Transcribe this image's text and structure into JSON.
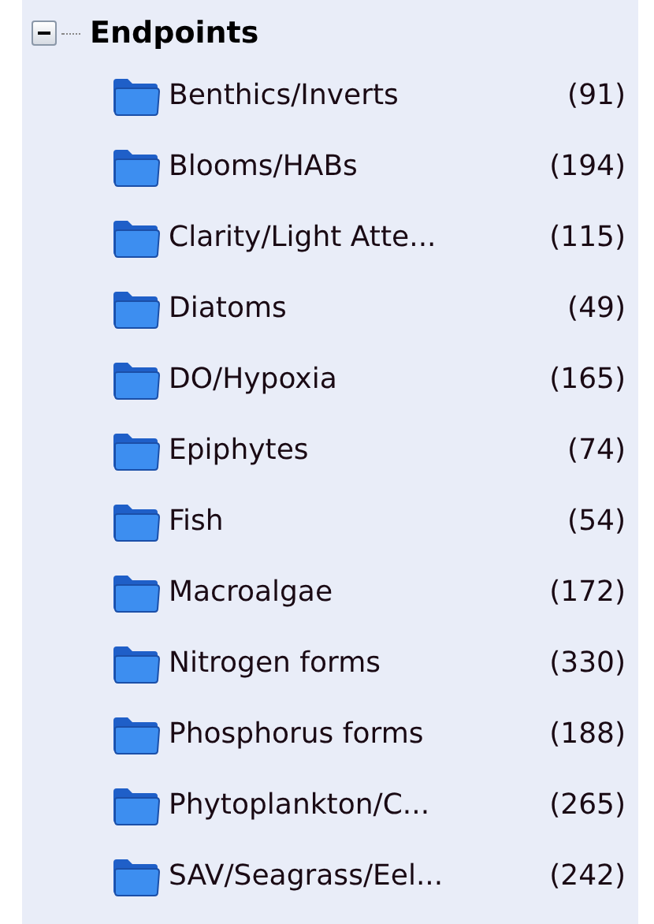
{
  "tree": {
    "label": "Endpoints",
    "expanded": true,
    "children": [
      {
        "label": "Benthics/Inverts",
        "count": "(91)"
      },
      {
        "label": "Blooms/HABs",
        "count": "(194)"
      },
      {
        "label": "Clarity/Light Atte...",
        "count": "(115)"
      },
      {
        "label": "Diatoms",
        "count": "(49)"
      },
      {
        "label": "DO/Hypoxia",
        "count": "(165)"
      },
      {
        "label": "Epiphytes",
        "count": "(74)"
      },
      {
        "label": "Fish",
        "count": "(54)"
      },
      {
        "label": "Macroalgae",
        "count": "(172)"
      },
      {
        "label": "Nitrogen forms",
        "count": "(330)"
      },
      {
        "label": "Phosphorus forms",
        "count": "(188)"
      },
      {
        "label": "Phytoplankton/C...",
        "count": "(265)"
      },
      {
        "label": "SAV/Seagrass/Eel...",
        "count": "(242)"
      }
    ]
  }
}
